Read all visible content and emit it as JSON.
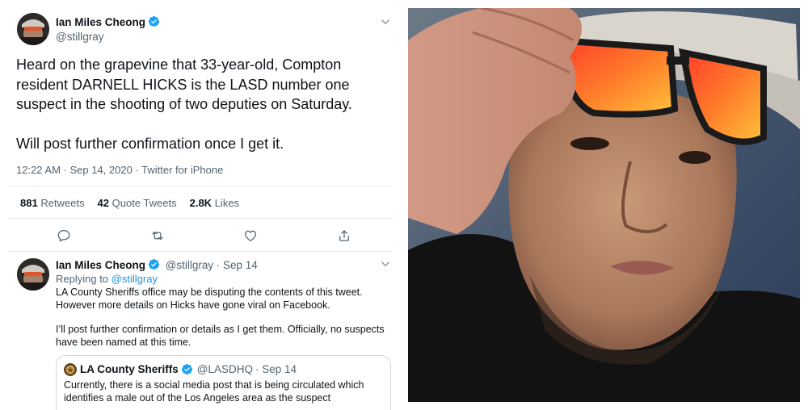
{
  "tweet": {
    "author_name": "Ian Miles Cheong",
    "author_handle": "@stillgray",
    "paragraphs": [
      "Heard on the grapevine that 33-year-old, Compton resident DARNELL HICKS is the LASD number one suspect in the shooting of two deputies on Saturday.",
      "Will post further confirmation once I get it."
    ],
    "meta": "12:22 AM · Sep 14, 2020 · Twitter for iPhone",
    "stats": {
      "retweets_count": "881",
      "retweets_label": "Retweets",
      "quote_count": "42",
      "quote_label": "Quote Tweets",
      "likes_count": "2.8K",
      "likes_label": "Likes"
    },
    "actions": [
      "reply-icon",
      "retweet-icon",
      "like-icon",
      "share-icon"
    ]
  },
  "reply": {
    "author_name": "Ian Miles Cheong",
    "author_handle": "@stillgray",
    "date": "· Sep 14",
    "replying_prefix": "Replying to",
    "replying_to": "@stillgray",
    "paragraphs": [
      "LA County Sheriffs office may be disputing the contents of this tweet. However more details on Hicks have gone viral on Facebook.",
      "I’ll post further confirmation or details as I get them. Officially, no suspects have been named at this time."
    ]
  },
  "quoted": {
    "author_name": "LA County Sheriffs",
    "author_handle": "@LASDHQ",
    "date": "· Sep 14",
    "text": "Currently, there is a social media post that is being circulated which identifies a male out of the Los Angeles area as the suspect"
  },
  "colors": {
    "accent": "#1da1f2",
    "text": "#0f1419",
    "muted": "#536471",
    "divider": "#e6ecf0"
  },
  "photo": {
    "description_icon": "portrait-photo"
  }
}
